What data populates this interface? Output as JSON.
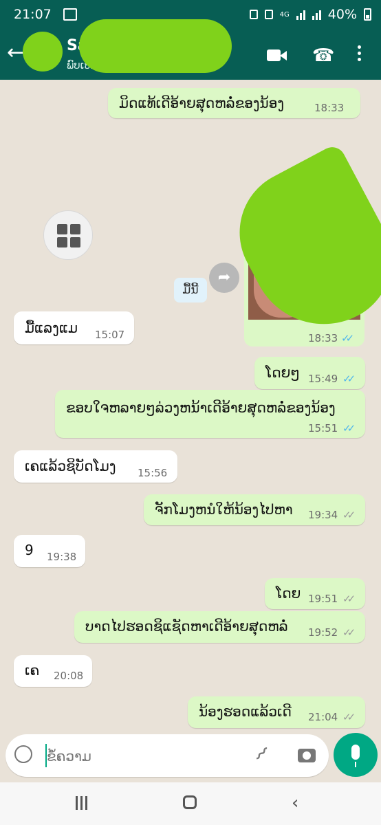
{
  "status": {
    "time": "21:07",
    "network": "4G",
    "battery": "40%"
  },
  "header": {
    "name": "Sa",
    "subtitle": "ພົບເຫັນລ່າສຸດ"
  },
  "messages": [
    {
      "text": "ມິດແທ້ເດີອ້າຍສຸດຫລໍ່ຂອງນ້ອງ",
      "time": "18:33",
      "type": "outgoing",
      "status": "read"
    },
    {
      "text": "",
      "time": "18:33",
      "type": "outgoing-photo",
      "status": "read"
    },
    {
      "text": "ມື້ນີ້",
      "type": "date"
    },
    {
      "text": "ມື້ແລງແມ",
      "time": "15:07",
      "type": "incoming"
    },
    {
      "text": "ໂດຍໆ",
      "time": "15:49",
      "type": "outgoing",
      "status": "read"
    },
    {
      "text": "ຂອບໃຈຫລາຍໆລ່ວງຫນ້າເດີອ້າຍສຸດຫລໍ່ຂອງນ້ອງ",
      "time": "15:51",
      "type": "outgoing",
      "status": "read"
    },
    {
      "text": "ເຄແລ້ວຊິບັດໂມງ",
      "time": "15:56",
      "type": "incoming"
    },
    {
      "text": "ຈັກໂມງຫນໍໃຫ້ນ້ອງໄປຫາ",
      "time": "19:34",
      "type": "outgoing",
      "status": "delivered"
    },
    {
      "text": "9",
      "time": "19:38",
      "type": "incoming"
    },
    {
      "text": "ໂດຍ",
      "time": "19:51",
      "type": "outgoing",
      "status": "delivered"
    },
    {
      "text": "ບາດໄປຮອດຊິແຊັດຫາເດີອ້າຍສຸດຫລໍ່",
      "time": "19:52",
      "type": "outgoing",
      "status": "delivered"
    },
    {
      "text": "ເຄ",
      "time": "20:08",
      "type": "incoming"
    },
    {
      "text": "ນ້ອງຮອດແລ້ວເດີ",
      "time": "21:04",
      "type": "outgoing",
      "status": "delivered"
    }
  ],
  "composer": {
    "placeholder": "ຂໍ້ຄວາມ"
  },
  "icons": [
    "back-arrow-icon",
    "video-icon",
    "phone-icon",
    "more-icon",
    "gallery-grid-icon",
    "share-icon",
    "emoji-icon",
    "attach-icon",
    "camera-icon",
    "mic-icon"
  ],
  "colors": {
    "header": "#075e54",
    "outgoing": "#dcf8c6",
    "incoming": "#ffffff",
    "accent": "#00a884",
    "read_ticks": "#4fb6ec"
  }
}
